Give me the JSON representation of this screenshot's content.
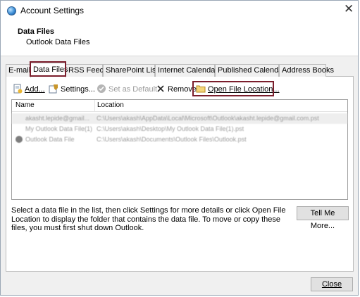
{
  "window": {
    "title": "Account Settings",
    "close_glyph": "✕"
  },
  "header": {
    "title": "Data Files",
    "subtitle": "Outlook Data Files"
  },
  "tabs": [
    {
      "label": "E-mail"
    },
    {
      "label": "Data Files",
      "active": true
    },
    {
      "label": "RSS Feeds"
    },
    {
      "label": "SharePoint Lists"
    },
    {
      "label": "Internet Calendars"
    },
    {
      "label": "Published Calendars"
    },
    {
      "label": "Address Books"
    }
  ],
  "toolbar": {
    "add": "Add...",
    "settings": "Settings...",
    "set_default": "Set as Default",
    "remove": "Remove",
    "open_location": "Open File Location..."
  },
  "list": {
    "columns": {
      "name": "Name",
      "location": "Location"
    },
    "rows": [
      {
        "name": "akasht.lepide@gmail...",
        "location": "C:\\Users\\akash\\AppData\\Local\\Microsoft\\Outlook\\akasht.lepide@gmail.com.pst"
      },
      {
        "name": "My Outlook Data File(1)",
        "location": "C:\\Users\\akash\\Desktop\\My Outlook Data File(1).pst"
      },
      {
        "name": "Outlook Data File",
        "location": "C:\\Users\\akash\\Documents\\Outlook Files\\Outlook.pst"
      }
    ]
  },
  "help_text": "Select a data file in the list, then click Settings for more details or click Open File Location to display the folder that contains the data file. To move or copy these files, you must first shut down Outlook.",
  "buttons": {
    "tell_me_more": "Tell Me More...",
    "close": "Close"
  },
  "colors": {
    "highlight": "#7b1e2c"
  },
  "icons": [
    "outlook-globe-icon",
    "add-file-icon",
    "settings-icon",
    "checkmark-icon",
    "delete-x-icon",
    "folder-icon",
    "default-check-icon"
  ]
}
